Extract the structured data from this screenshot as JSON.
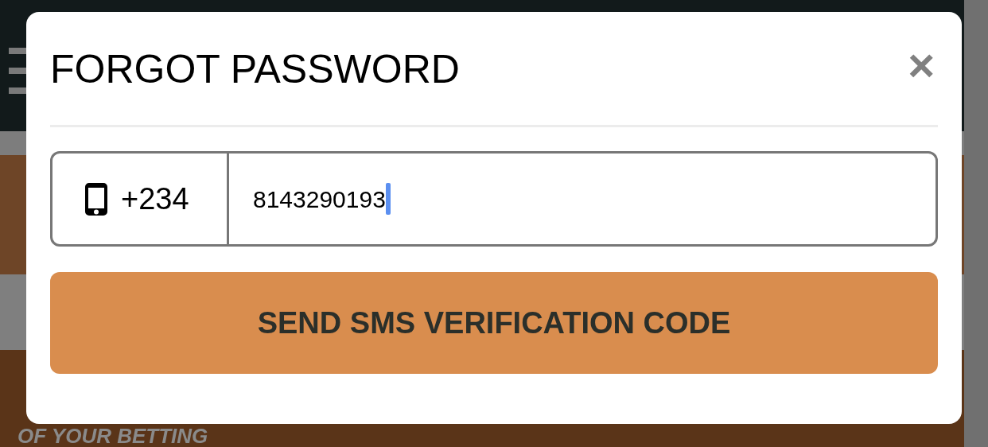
{
  "background": {
    "headline": "OF YOUR BETTING"
  },
  "dialog": {
    "title": "FORGOT PASSWORD",
    "close_label": "×",
    "phone": {
      "country_code": "+234",
      "value": "8143290193",
      "focused": true
    },
    "submit": "SEND SMS VERIFICATION CODE"
  }
}
